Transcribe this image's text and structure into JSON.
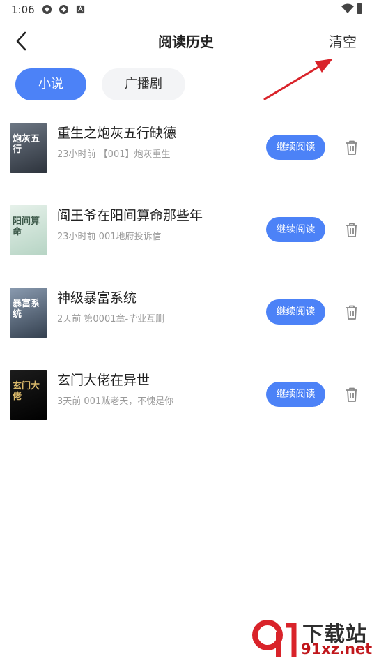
{
  "status_bar": {
    "time": "1:06"
  },
  "header": {
    "title": "阅读历史",
    "clear_label": "清空"
  },
  "tabs": [
    {
      "label": "小说",
      "active": true
    },
    {
      "label": "广播剧",
      "active": false
    }
  ],
  "books": [
    {
      "title": "重生之炮灰五行缺德",
      "meta": "23小时前 【001】炮灰重生",
      "cover_text": "炮灰五行",
      "cover_color": "#4a5360"
    },
    {
      "title": "阎王爷在阳间算命那些年",
      "meta": "23小时前 001地府投诉信",
      "cover_text": "阳间算命",
      "cover_color": "#cfe3d8"
    },
    {
      "title": "神级暴富系统",
      "meta": "2天前 第0001章-毕业互删",
      "cover_text": "暴富系统",
      "cover_color": "#5b6e82"
    },
    {
      "title": "玄门大佬在异世",
      "meta": "3天前 001贼老天，不愧是你",
      "cover_text": "玄门大佬",
      "cover_color": "#111111"
    }
  ],
  "continue_label": "继续阅读",
  "watermark": {
    "big": "下载站",
    "small": "91xz.net"
  },
  "colors": {
    "accent": "#4c82f7",
    "annotation_arrow": "#d9232a"
  }
}
